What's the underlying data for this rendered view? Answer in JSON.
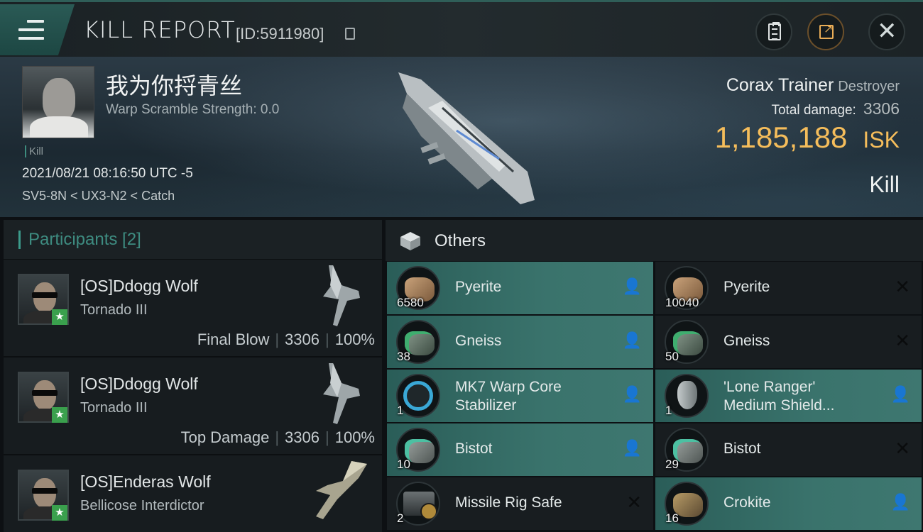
{
  "header": {
    "title": "KILL REPORT",
    "report_id": "[ID:5911980]"
  },
  "victim": {
    "name": "我为你捋青丝",
    "warp_scramble": "Warp Scramble Strength: 0.0",
    "kill_tag": "Kill",
    "datetime": "2021/08/21 08:16:50 UTC -5",
    "location": "SV5-8N < UX3-N2 < Catch",
    "ship_name": "Corax Trainer",
    "ship_class": "Destroyer",
    "total_damage_label": "Total damage:",
    "total_damage": "3306",
    "isk_value": "1,185,188",
    "isk_unit": "ISK",
    "result": "Kill"
  },
  "participants": {
    "label": "Participants [2]",
    "rows": [
      {
        "name": "[OS]Ddogg Wolf",
        "ship": "Tornado III",
        "role": "Final Blow",
        "damage": "3306",
        "percent": "100%"
      },
      {
        "name": "[OS]Ddogg Wolf",
        "ship": "Tornado III",
        "role": "Top Damage",
        "damage": "3306",
        "percent": "100%"
      },
      {
        "name": "[OS]Enderas Wolf",
        "ship": "Bellicose Interdictor"
      }
    ]
  },
  "others": {
    "label": "Others",
    "items": [
      {
        "name": "Pyerite",
        "qty": "6580",
        "status": "dropped",
        "icon": "pyerite-icon"
      },
      {
        "name": "Pyerite",
        "qty": "10040",
        "status": "destroyed",
        "icon": "pyerite-icon"
      },
      {
        "name": "Gneiss",
        "qty": "38",
        "status": "dropped",
        "icon": "gneiss-icon"
      },
      {
        "name": "Gneiss",
        "qty": "50",
        "status": "destroyed",
        "icon": "gneiss-icon"
      },
      {
        "name_line1": "MK7 Warp Core",
        "name_line2": "Stabilizer",
        "qty": "1",
        "status": "dropped",
        "icon": "warp-core-icon"
      },
      {
        "name_line1": "'Lone Ranger'",
        "name_line2": "Medium Shield...",
        "qty": "1",
        "status": "dropped",
        "icon": "shield-module-icon"
      },
      {
        "name": "Bistot",
        "qty": "10",
        "status": "dropped",
        "icon": "bistot-icon"
      },
      {
        "name": "Bistot",
        "qty": "29",
        "status": "destroyed",
        "icon": "bistot-icon"
      },
      {
        "name": "Missile Rig Safe",
        "qty": "2",
        "status": "destroyed",
        "icon": "missile-rig-icon"
      },
      {
        "name": "Crokite",
        "qty": "16",
        "status": "dropped",
        "icon": "crokite-icon"
      }
    ]
  },
  "colors": {
    "accent_teal": "#3c9b8b",
    "isk_gold": "#f5bd5b",
    "dropped_bg": "#3a736c",
    "destroyed_bg": "#181d20"
  }
}
